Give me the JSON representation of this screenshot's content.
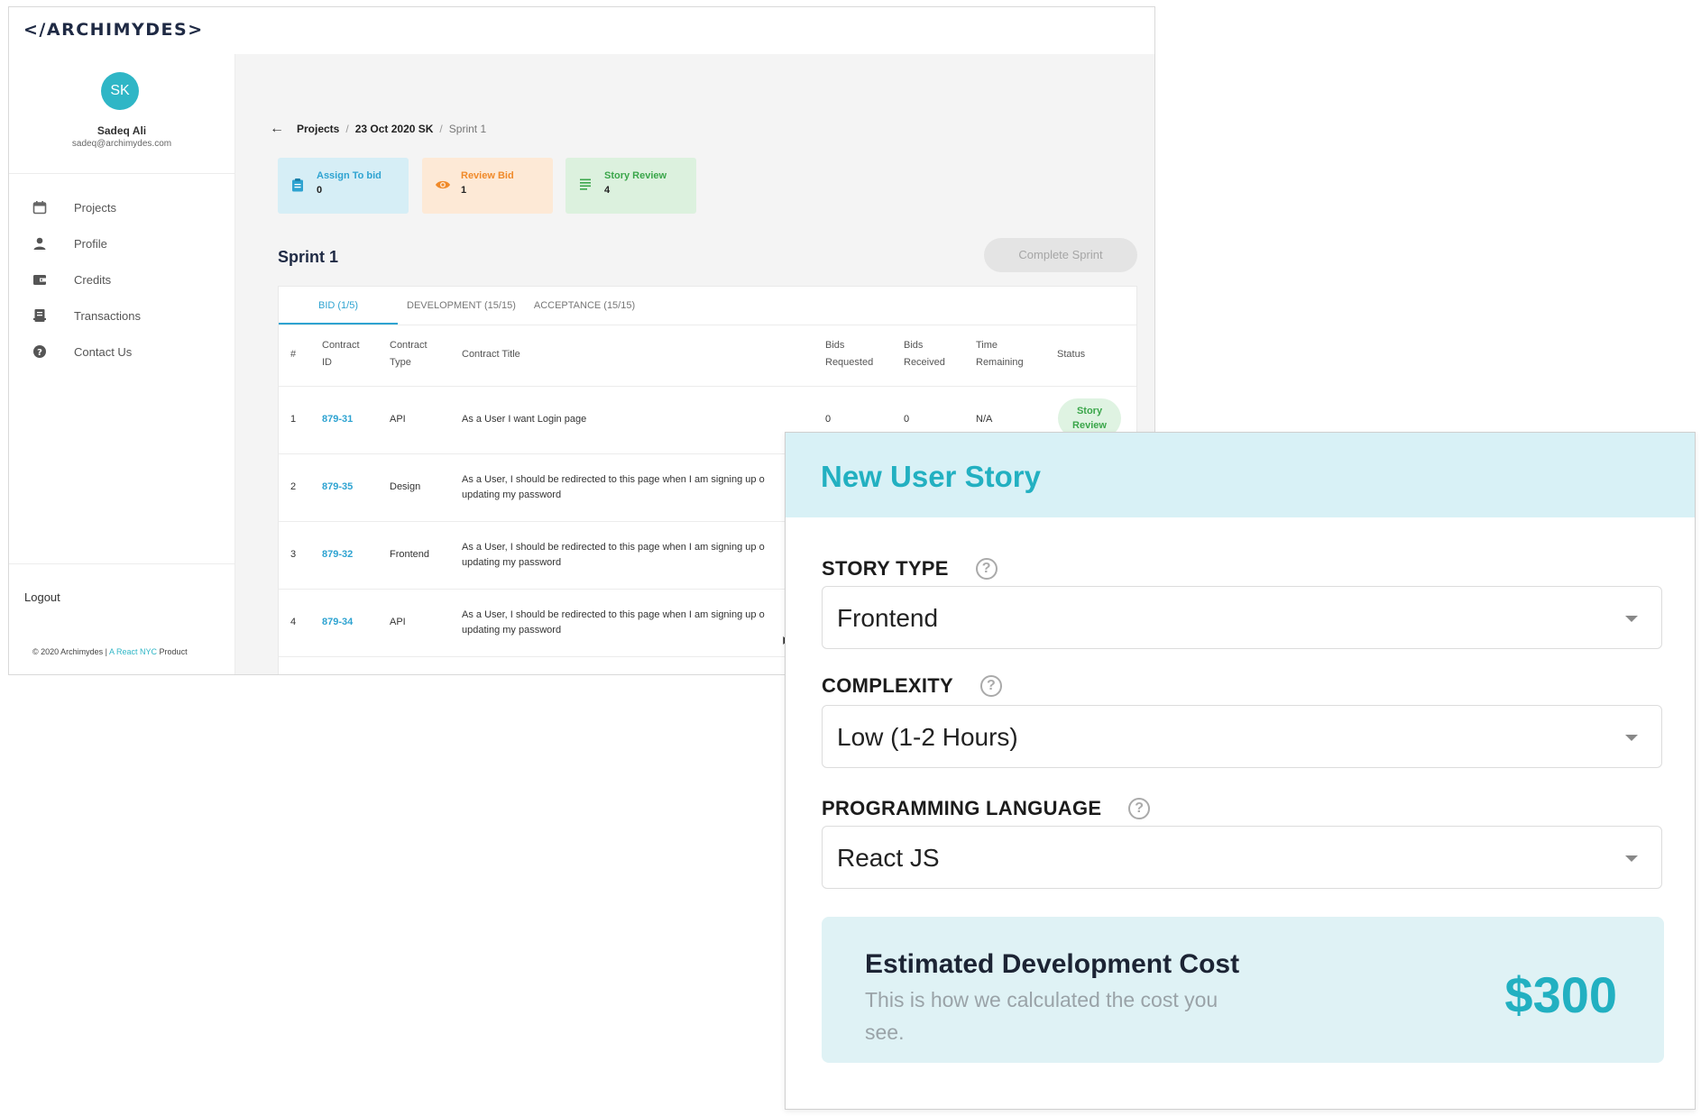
{
  "app": {
    "logo_prefix": "</",
    "logo_text": "ARCHIMYDES",
    "logo_suffix": ">"
  },
  "user": {
    "initials": "SK",
    "name": "Sadeq Ali",
    "email": "sadeq@archimydes.com"
  },
  "sidebar": {
    "items": [
      {
        "label": "Projects",
        "icon": "calendar-icon"
      },
      {
        "label": "Profile",
        "icon": "person-icon"
      },
      {
        "label": "Credits",
        "icon": "wallet-icon"
      },
      {
        "label": "Transactions",
        "icon": "receipt-icon"
      },
      {
        "label": "Contact Us",
        "icon": "help-circle-icon"
      }
    ],
    "logout": "Logout",
    "copyright_prefix": "© 2020 Archimydes | ",
    "copyright_link": "A React NYC",
    "copyright_suffix": " Product"
  },
  "breadcrumb": {
    "items": [
      "Projects",
      "23 Oct 2020 SK",
      "Sprint 1"
    ]
  },
  "stats": [
    {
      "label": "Assign To bid",
      "value": "0",
      "color": "#2ea3d1"
    },
    {
      "label": "Review Bid",
      "value": "1",
      "color": "#f08a2a"
    },
    {
      "label": "Story Review",
      "value": "4",
      "color": "#3aa64a"
    }
  ],
  "sprint": {
    "title": "Sprint 1",
    "complete_button": "Complete Sprint"
  },
  "tabs": [
    "BID (1/5)",
    "DEVELOPMENT (15/15)",
    "ACCEPTANCE (15/15)"
  ],
  "table": {
    "headers": {
      "num": "#",
      "contract_id_1": "Contract",
      "contract_id_2": "ID",
      "contract_type_1": "Contract",
      "contract_type_2": "Type",
      "title": "Contract Title",
      "bids_req_1": "Bids",
      "bids_req_2": "Requested",
      "bids_rec_1": "Bids",
      "bids_rec_2": "Received",
      "time_1": "Time",
      "time_2": "Remaining",
      "status": "Status"
    },
    "rows": [
      {
        "num": "1",
        "id": "879-31",
        "type": "API",
        "title_1": "As a User I want Login page",
        "title_2": "",
        "bids_req": "0",
        "bids_rec": "0",
        "time": "N/A",
        "status_1": "Story",
        "status_2": "Review"
      },
      {
        "num": "2",
        "id": "879-35",
        "type": "Design",
        "title_1": "As a User, I should be redirected to this page when I am signing up o",
        "title_2": "updating my password"
      },
      {
        "num": "3",
        "id": "879-32",
        "type": "Frontend",
        "title_1": "As a User, I should be redirected to this page when I am signing up o",
        "title_2": "updating my password"
      },
      {
        "num": "4",
        "id": "879-34",
        "type": "API",
        "title_1": "As a User, I should be redirected to this page when I am signing up o",
        "title_2": "updating my password"
      }
    ]
  },
  "modal": {
    "title": "New User Story",
    "story_type": {
      "label": "STORY TYPE",
      "value": "Frontend"
    },
    "complexity": {
      "label": "COMPLEXITY",
      "value": "Low (1-2 Hours)"
    },
    "language": {
      "label": "PROGRAMMING LANGUAGE",
      "value": "React JS"
    },
    "help_glyph": "?",
    "cost": {
      "title": "Estimated Development Cost",
      "subtitle": "This is how we calculated the cost you see.",
      "value": "$300"
    }
  },
  "colors": {
    "accent": "#22b0c1",
    "link": "#2ea3d1"
  }
}
